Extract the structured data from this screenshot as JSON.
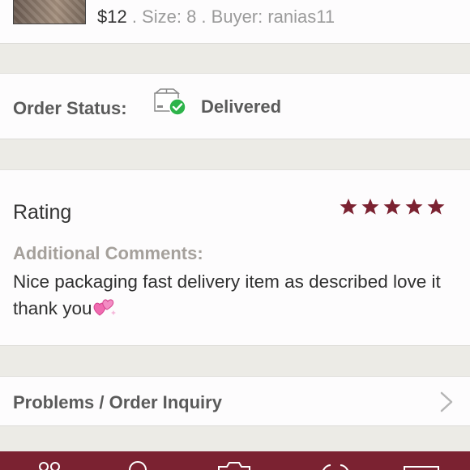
{
  "item": {
    "price": "$12",
    "size_text": " . Size: 8 . ",
    "buyer_text": "Buyer: ranias11"
  },
  "order_status": {
    "label": "Order Status:",
    "value": "Delivered",
    "icon": "delivered-box-icon"
  },
  "rating": {
    "title": "Rating",
    "stars": 5,
    "max_stars": 5,
    "star_color": "#7b2231",
    "comments_label": "Additional Comments:",
    "comment": "Nice packaging fast delivery item as described love it thank you"
  },
  "problems": {
    "label": "Problems / Order Inquiry"
  },
  "colors": {
    "accent": "#7b2231",
    "success": "#2db34a"
  },
  "tabbar": {
    "icons": [
      "community-icon",
      "search-icon",
      "camera-icon",
      "news-icon",
      "account-icon"
    ]
  }
}
